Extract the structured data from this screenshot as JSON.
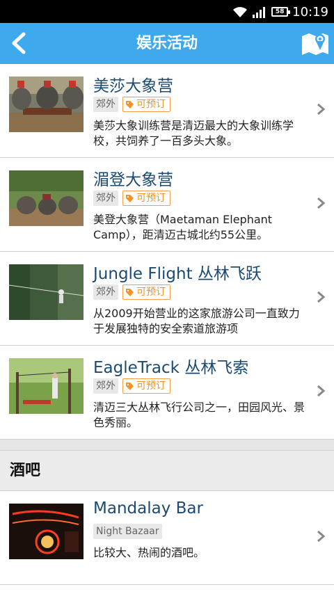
{
  "status_bar": {
    "time": "10:19",
    "battery": "58"
  },
  "nav": {
    "title": "娱乐活动"
  },
  "items": [
    {
      "title": "美莎大象营",
      "area": "郊外",
      "book": "可预订",
      "desc": "美莎大象训练营是清迈最大的大象训练学校，共饲养了一百多头大象。"
    },
    {
      "title": "湄登大象营",
      "area": "郊外",
      "book": "可预订",
      "desc": "美登大象营（Maetaman Elephant Camp），距清迈古城北约55公里。"
    },
    {
      "title": "Jungle Flight 丛林飞跃",
      "area": "郊外",
      "book": "可预订",
      "desc": "从2009开始营业的这家旅游公司一直致力于发展独特的安全索道旅游项"
    },
    {
      "title": "EagleTrack  丛林飞索",
      "area": "郊外",
      "book": "可预订",
      "desc": "清迈三大丛林飞行公司之一，田园风光、景色秀丽。"
    }
  ],
  "bar_section": {
    "header": "酒吧",
    "item": {
      "title": "Mandalay Bar",
      "area": "Night Bazaar",
      "desc": "比较大、热闹的酒吧。"
    }
  },
  "colors": {
    "nav": "#3fa9ee",
    "title_text": "#1b4a72",
    "book_tag": "#f39225"
  }
}
